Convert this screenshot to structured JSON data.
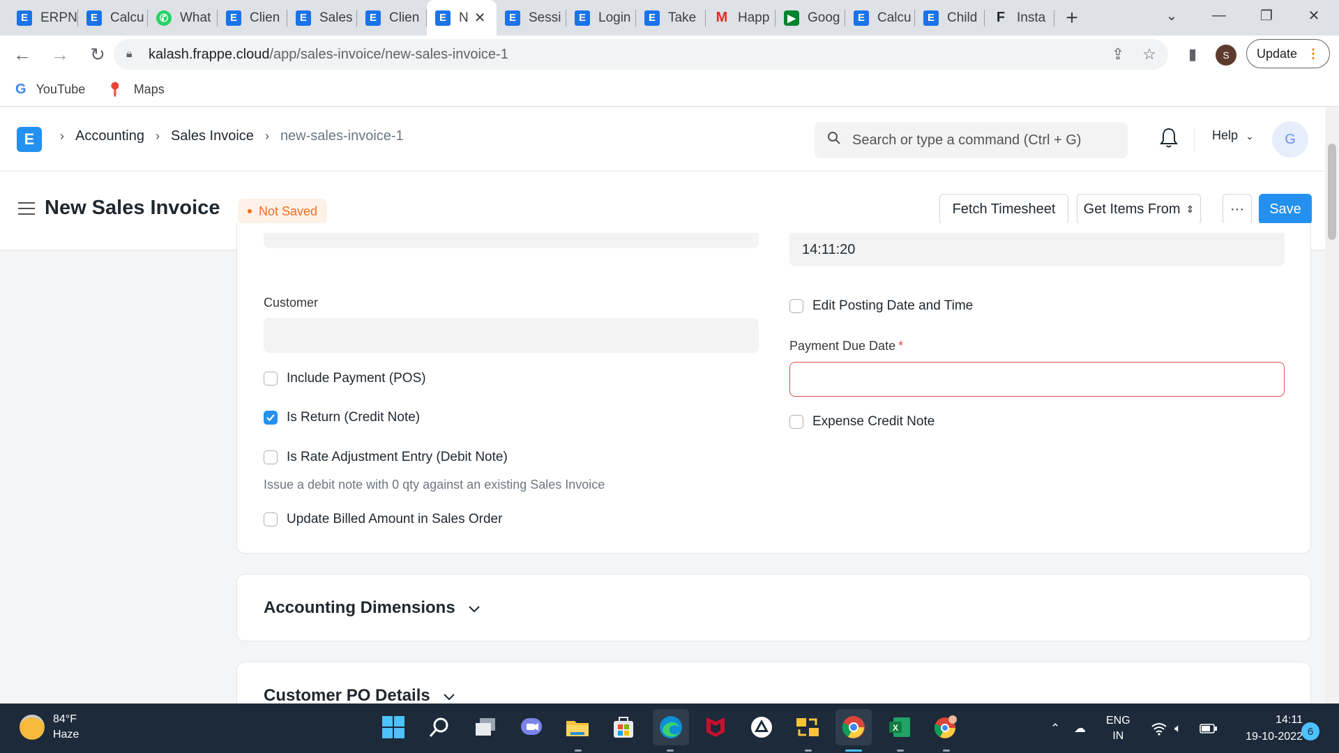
{
  "browser": {
    "tabs": [
      {
        "label": "ERPN",
        "favicon": "erpnext-icon"
      },
      {
        "label": "Calcu",
        "favicon": "erpnext-icon"
      },
      {
        "label": "What",
        "favicon": "whatsapp-icon"
      },
      {
        "label": "Clien",
        "favicon": "erpnext-icon"
      },
      {
        "label": "Sales",
        "favicon": "erpnext-icon"
      },
      {
        "label": "Clien",
        "favicon": "erpnext-icon"
      },
      {
        "label": "N",
        "favicon": "erpnext-icon",
        "active": true
      },
      {
        "label": "Sessi",
        "favicon": "erpnext-icon"
      },
      {
        "label": "Login",
        "favicon": "erpnext-icon"
      },
      {
        "label": "Take",
        "favicon": "erpnext-icon"
      },
      {
        "label": "Happ",
        "favicon": "gmail-icon"
      },
      {
        "label": "Goog",
        "favicon": "google-meet-icon"
      },
      {
        "label": "Calcu",
        "favicon": "erpnext-icon"
      },
      {
        "label": "Child",
        "favicon": "erpnext-icon"
      },
      {
        "label": "Insta",
        "favicon": "frappe-icon"
      }
    ],
    "url_host": "kalash.frappe.cloud",
    "url_path": "/app/sales-invoice/new-sales-invoice-1",
    "profile_initial": "S",
    "update_label": "Update",
    "bookmarks": [
      {
        "label": "YouTube",
        "icon": "google-icon"
      },
      {
        "label": "Maps",
        "icon": "maps-pin-icon"
      }
    ]
  },
  "app": {
    "logo_letter": "E",
    "breadcrumbs": [
      "Accounting",
      "Sales Invoice",
      "new-sales-invoice-1"
    ],
    "search_placeholder": "Search or type a command (Ctrl + G)",
    "help_label": "Help",
    "avatar_initial": "G",
    "accent_color": "#2490ef"
  },
  "page": {
    "title": "New Sales Invoice",
    "status": "Not Saved",
    "actions": {
      "fetch_timesheet": "Fetch Timesheet",
      "get_items_from": "Get Items From",
      "more": "···",
      "save": "Save"
    }
  },
  "form": {
    "posting_time_value": "14:11:20",
    "customer_label": "Customer",
    "customer_value": "",
    "include_payment_label": "Include Payment (POS)",
    "include_payment_checked": false,
    "is_return_label": "Is Return (Credit Note)",
    "is_return_checked": true,
    "rate_adjustment_label": "Is Rate Adjustment Entry (Debit Note)",
    "rate_adjustment_checked": false,
    "rate_adjustment_help": "Issue a debit note with 0 qty against an existing Sales Invoice",
    "update_billed_label": "Update Billed Amount in Sales Order",
    "update_billed_checked": false,
    "edit_posting_label": "Edit Posting Date and Time",
    "edit_posting_checked": false,
    "payment_due_label": "Payment Due Date",
    "payment_due_required": "*",
    "payment_due_value": "",
    "expense_credit_label": "Expense Credit Note",
    "expense_credit_checked": false
  },
  "sections": {
    "accounting_dimensions": "Accounting Dimensions",
    "customer_po_details": "Customer PO Details"
  },
  "taskbar": {
    "weather_temp": "84°F",
    "weather_desc": "Haze",
    "lang_line1": "ENG",
    "lang_line2": "IN",
    "time": "14:11",
    "date": "19-10-2022",
    "notification_count": "6"
  }
}
